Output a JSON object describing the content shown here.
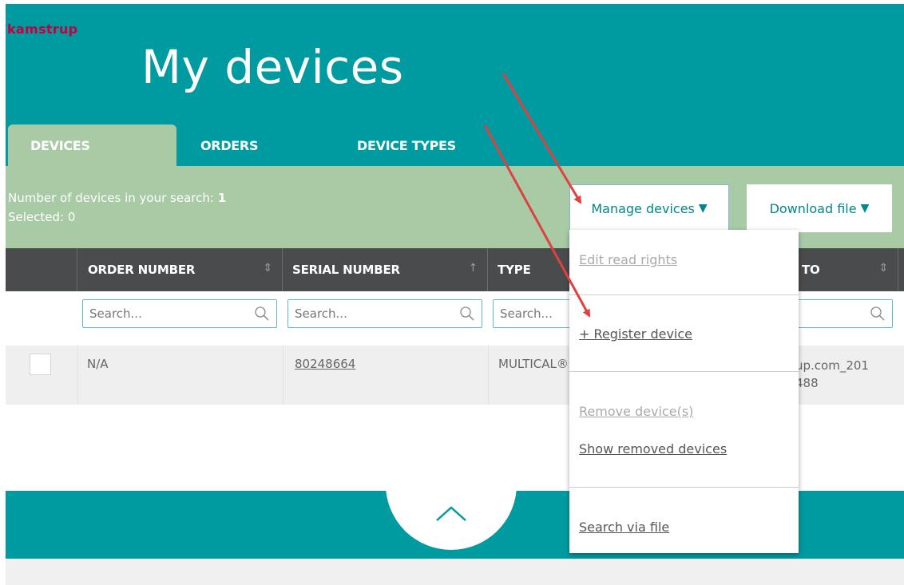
{
  "brand": {
    "logo_text": "kamstrup"
  },
  "header": {
    "title": "My devices"
  },
  "tabs": [
    {
      "label": "DEVICES",
      "active": true
    },
    {
      "label": "ORDERS",
      "active": false
    },
    {
      "label": "DEVICE TYPES",
      "active": false
    }
  ],
  "summary": {
    "count_label": "Number of devices in your search:",
    "count_value": "1",
    "selected_label": "Selected:",
    "selected_value": "0"
  },
  "actions": {
    "manage_label": "Manage devices",
    "download_label": "Download file",
    "caret_icon": "caret-down-icon"
  },
  "table": {
    "columns": [
      "ORDER NUMBER",
      "SERIAL NUMBER",
      "TYPE",
      "TO"
    ],
    "search_placeholder": "Search...",
    "rows": [
      {
        "order_number": "N/A",
        "serial_number": "80248664",
        "type": "MULTICAL®",
        "to_line1": "up.com_201",
        "to_line2": "488"
      }
    ]
  },
  "dropdown": {
    "items": [
      {
        "label": "Edit read rights",
        "enabled": false
      },
      {
        "label": "+ Register device",
        "enabled": true
      },
      {
        "label": "Remove device(s)",
        "enabled": false
      },
      {
        "label": "Show removed devices",
        "enabled": true
      },
      {
        "label": "Search via file",
        "enabled": true
      }
    ]
  },
  "colors": {
    "header_teal": "#009aa1",
    "summary_green": "#a8cba6",
    "table_header": "#4a4b4d",
    "logo_red": "#c6003f",
    "annotation_arrow": "#e04040"
  }
}
